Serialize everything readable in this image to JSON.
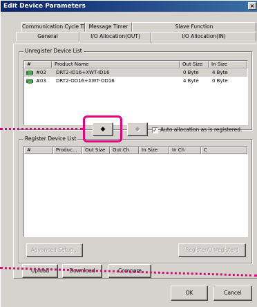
{
  "window": {
    "title": "Edit Device Parameters",
    "close_glyph": "×"
  },
  "tabs": {
    "back": [
      "Communication Cycle Time",
      "Message Timer",
      "Slave Function"
    ],
    "front": [
      "General",
      "I/O Allocation(OUT)",
      "I/O Allocation(IN)"
    ],
    "active": "I/O Allocation(OUT)"
  },
  "unregister": {
    "label": "Unregister Device List",
    "columns": [
      "#",
      "Product Name",
      "Out Size",
      "In Size"
    ],
    "rows": [
      {
        "num": "#02",
        "product": "DRT2-ID16+XWT-ID16",
        "out": "0 Byte",
        "in": "4 Byte",
        "selected": true
      },
      {
        "num": "#03",
        "product": "DRT2-OD16+XWT-OD16",
        "out": "4 Byte",
        "in": "0 Byte",
        "selected": false
      }
    ]
  },
  "transfer": {
    "down_arrow": "◆",
    "up_arrow": "◆",
    "auto_allocation_label": "Auto allocation as is registered.",
    "auto_allocation_checked": true,
    "check_glyph": "✓"
  },
  "register": {
    "label": "Register Device List",
    "columns": [
      "#",
      "Produc...",
      "Out Size",
      "Out Ch",
      "In Size",
      "In Ch",
      "C"
    ]
  },
  "buttons": {
    "advanced": "Advanced Setup...",
    "register_unregister": "Register/Unregisterd",
    "upload": "Upload",
    "download": "Download",
    "compare": "Compare",
    "ok": "OK",
    "cancel": "Cancel"
  },
  "colors": {
    "highlight": "#e6007e",
    "title_bar": "#0a246a",
    "face": "#d6d3ce"
  },
  "icons": {
    "device": "device-chip-icon"
  }
}
